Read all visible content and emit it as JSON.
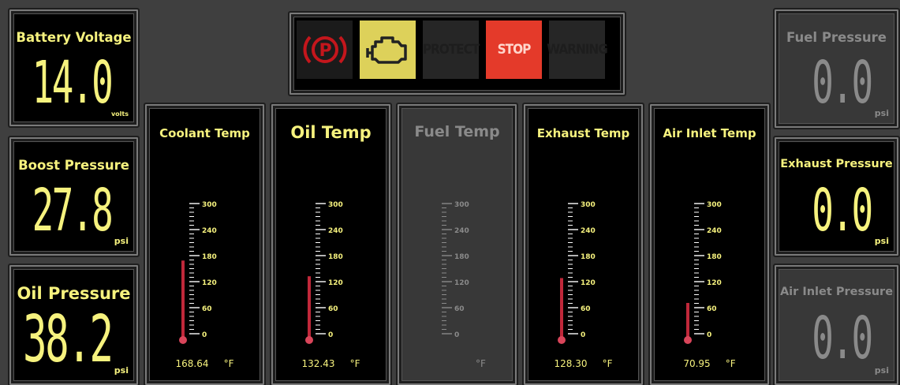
{
  "left_gauges": [
    {
      "title": "Battery Voltage",
      "value": "14.0",
      "unit": "volts"
    },
    {
      "title": "Boost Pressure",
      "value": "27.8",
      "unit": "psi"
    },
    {
      "title": "Oil Pressure",
      "value": "38.2",
      "unit": "psi"
    }
  ],
  "right_gauges": [
    {
      "title": "Fuel Pressure",
      "value": "0.0",
      "unit": "psi",
      "active": false
    },
    {
      "title": "Exhaust Pressure",
      "value": "0.0",
      "unit": "psi",
      "active": true
    },
    {
      "title": "Air Inlet Pressure",
      "value": "0.0",
      "unit": "psi",
      "active": false
    }
  ],
  "lamps": [
    {
      "name": "parking-brake",
      "label": "",
      "state": "off"
    },
    {
      "name": "check-engine",
      "label": "",
      "state": "on"
    },
    {
      "name": "protect",
      "label": "PROTECT",
      "state": "off"
    },
    {
      "name": "stop",
      "label": "STOP",
      "state": "on"
    },
    {
      "name": "warning",
      "label": "WARNING",
      "state": "off"
    }
  ],
  "temperatures": [
    {
      "title": "Coolant Temp",
      "reading": "168.64",
      "unit": "°F",
      "value": 168.64,
      "active": true
    },
    {
      "title": "Oil Temp",
      "reading": "132.43",
      "unit": "°F",
      "value": 132.43,
      "active": true
    },
    {
      "title": "Fuel Temp",
      "reading": "",
      "unit": "°F",
      "value": 0,
      "active": false
    },
    {
      "title": "Exhaust Temp",
      "reading": "128.30",
      "unit": "°F",
      "value": 128.3,
      "active": true
    },
    {
      "title": "Air Inlet Temp",
      "reading": "70.95",
      "unit": "°F",
      "value": 70.95,
      "active": true
    }
  ],
  "scale": {
    "ticks": [
      "300",
      "240",
      "180",
      "120",
      "60",
      "0"
    ],
    "min": 0,
    "max": 300
  },
  "colors": {
    "accent": "#f6f27e",
    "dim": "#8a8a8a",
    "mercury": "#c0283a",
    "stop": "#e43a2a",
    "engine": "#ddd15a"
  }
}
